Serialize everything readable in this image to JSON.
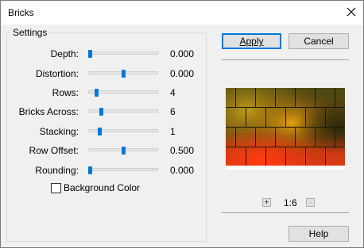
{
  "window": {
    "title": "Bricks"
  },
  "settings": {
    "group_label": "Settings",
    "sliders": [
      {
        "label": "Depth:",
        "value": "0.000",
        "level": 0.0
      },
      {
        "label": "Distortion:",
        "value": "0.000",
        "level": 0.5
      },
      {
        "label": "Rows:",
        "value": "4",
        "level": 0.1
      },
      {
        "label": "Bricks Across:",
        "value": "6",
        "level": 0.17
      },
      {
        "label": "Stacking:",
        "value": "1",
        "level": 0.14
      },
      {
        "label": "Row Offset:",
        "value": "0.500",
        "level": 0.5
      },
      {
        "label": "Rounding:",
        "value": "0.000",
        "level": 0.0
      }
    ],
    "background_color": {
      "label": "Background Color",
      "checked": false
    }
  },
  "buttons": {
    "apply": "Apply",
    "cancel": "Cancel",
    "help": "Help"
  },
  "zoom": {
    "plus_icon": "+",
    "level": "1:6",
    "minus_icon": "-"
  },
  "colors": {
    "accent": "#0078d7"
  }
}
